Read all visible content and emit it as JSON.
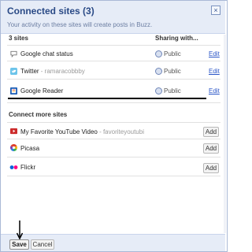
{
  "dialog": {
    "title": "Connected sites (3)",
    "subtitle": "Your activity on these sites will create posts in Buzz.",
    "close_label": "×"
  },
  "sites_header": {
    "count_label": "3 sites",
    "sharing_label": "Sharing with..."
  },
  "connected_sites": [
    {
      "name": "Google chat status",
      "detail": "",
      "icon": "speech-bubble-icon",
      "visibility": "Public",
      "action": "Edit"
    },
    {
      "name": "Twitter",
      "detail": " - ramaracobbby",
      "icon": "twitter-bird-icon",
      "visibility": "Public",
      "action": "Edit"
    },
    {
      "name": "Google Reader",
      "detail": "",
      "icon": "google-reader-icon",
      "visibility": "Public",
      "action": "Edit"
    }
  ],
  "connect_more": {
    "heading": "Connect more sites",
    "items": [
      {
        "name": "My Favorite YouTube Video",
        "detail": " - favoriteyoutubi",
        "icon": "youtube-icon",
        "action": "Add"
      },
      {
        "name": "Picasa",
        "detail": "",
        "icon": "picasa-icon",
        "action": "Add"
      },
      {
        "name": "Flickr",
        "detail": "",
        "icon": "flickr-icon",
        "action": "Add"
      }
    ]
  },
  "footer": {
    "save_label": "Save",
    "cancel_label": "Cancel"
  },
  "colors": {
    "header_bg": "#e6ecf7",
    "title": "#2a4a86",
    "link": "#2a55c7"
  }
}
